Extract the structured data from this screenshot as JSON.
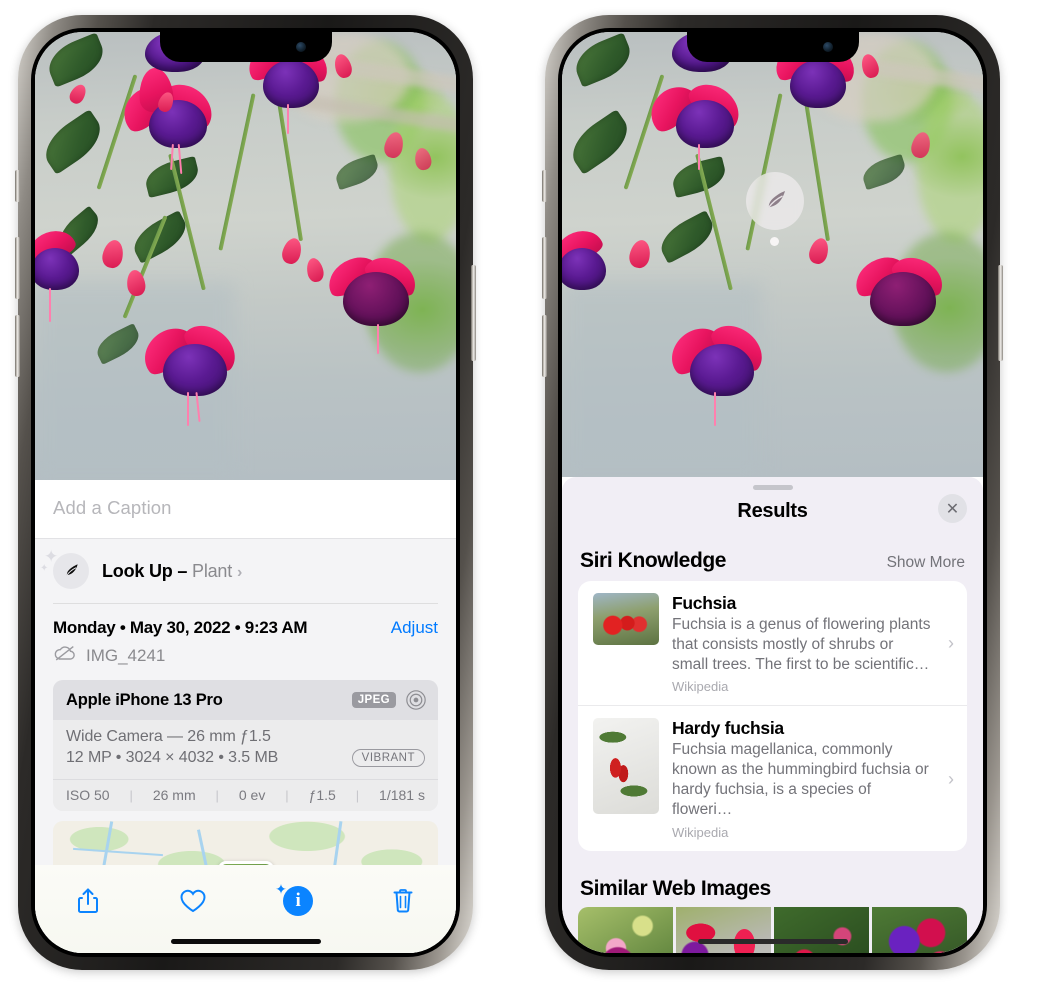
{
  "left_phone": {
    "caption": {
      "placeholder": "Add a Caption",
      "value": ""
    },
    "look_up": {
      "icon": "leaf-icon",
      "label": "Look Up – ",
      "subject": "Plant",
      "chevron": "›"
    },
    "date_line": "Monday • May 30, 2022 • 9:23 AM",
    "adjust_label": "Adjust",
    "cloud_icon": "icloud-slash-icon",
    "file_name": "IMG_4241",
    "exif": {
      "device": "Apple iPhone 13 Pro",
      "format_badge": "JPEG",
      "aperture_icon": "aperture-icon",
      "lens_line": "Wide Camera — 26 mm ƒ1.5",
      "size_line": "12 MP • 3024 × 4032 • 3.5 MB",
      "style_badge": "VIBRANT",
      "stats": [
        "ISO 50",
        "26 mm",
        "0 ev",
        "ƒ1.5",
        "1/181 s"
      ]
    },
    "toolbar": [
      {
        "name": "share-button",
        "icon": "share-icon"
      },
      {
        "name": "favorite-button",
        "icon": "heart-icon"
      },
      {
        "name": "info-button",
        "icon": "info-sparkle-icon",
        "active": true
      },
      {
        "name": "delete-button",
        "icon": "trash-icon"
      }
    ]
  },
  "right_phone": {
    "visual_lookup_badge": {
      "icon": "leaf-icon"
    },
    "sheet": {
      "title": "Results",
      "close_icon": "close-icon"
    },
    "siri_knowledge": {
      "title": "Siri Knowledge",
      "show_more": "Show More",
      "items": [
        {
          "title": "Fuchsia",
          "description": "Fuchsia is a genus of flowering plants that consists mostly of shrubs or small trees. The first to be scientific…",
          "source": "Wikipedia",
          "chevron": "›"
        },
        {
          "title": "Hardy fuchsia",
          "description": "Fuchsia magellanica, commonly known as the hummingbird fuchsia or hardy fuchsia, is a species of floweri…",
          "source": "Wikipedia",
          "chevron": "›"
        }
      ]
    },
    "similar_web_images": {
      "title": "Similar Web Images",
      "thumbnails": [
        "web-image-1",
        "web-image-2",
        "web-image-3",
        "web-image-4"
      ]
    }
  },
  "colors": {
    "accent_blue": "#007aff",
    "sheet_background": "#f1eef5",
    "info_background": "#f4f4f6",
    "secondary_text": "#8a8a8e"
  }
}
